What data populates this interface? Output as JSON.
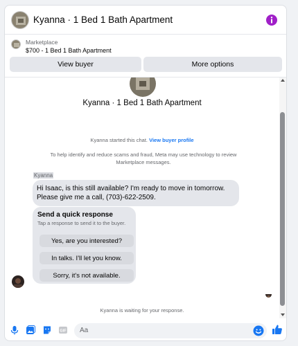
{
  "header": {
    "title": "Kyanna · 1 Bed 1 Bath Apartment"
  },
  "listing": {
    "source": "Marketplace",
    "name": "$700 - 1 Bed 1 Bath Apartment"
  },
  "actions": {
    "view_buyer": "View buyer",
    "more_options": "More options"
  },
  "chat": {
    "title": "Kyanna · 1 Bed 1 Bath Apartment",
    "started_text": "Kyanna started this chat. ",
    "view_profile": "View buyer profile",
    "notice": "To help identify and reduce scams and fraud, Meta may use technology to review Marketplace messages.",
    "sender": "Kyanna",
    "message": "Hi Isaac, is this still available? I'm ready to move in tomorrow. Please give me a call, (703)-622-2509.",
    "quick_title": "Send a quick response",
    "quick_subtitle": "Tap a response to send it to the buyer.",
    "quick_options": [
      "Yes, are you interested?",
      "In talks. I'll let you know.",
      "Sorry, it's not available."
    ],
    "waiting": "Kyanna is waiting for your response."
  },
  "composer": {
    "placeholder": "Aa"
  },
  "colors": {
    "accent": "#1877f2",
    "info": "#a020c8",
    "bubble": "#e4e6eb"
  },
  "icons": [
    "info-icon",
    "microphone-icon",
    "photo-icon",
    "sticker-icon",
    "gif-icon",
    "emoji-icon",
    "thumbs-up-icon"
  ]
}
